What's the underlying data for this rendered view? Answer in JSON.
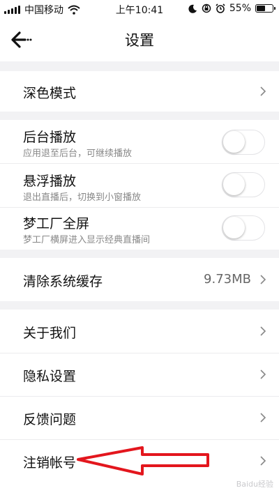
{
  "status_bar": {
    "carrier": "中国移动",
    "time": "上午10:41",
    "battery_percent_label": "55%",
    "battery_level": 0.55,
    "icons": [
      "signal-icon",
      "wifi-icon",
      "moon-icon",
      "orientation-lock-icon",
      "alarm-icon",
      "battery-icon"
    ]
  },
  "header": {
    "title": "设置",
    "back_icon": "back-arrow-icon"
  },
  "sections": {
    "dark_mode": {
      "label": "深色模式"
    },
    "background_play": {
      "label": "后台播放",
      "description": "应用退至后台，可继续播放",
      "enabled": false
    },
    "floating_play": {
      "label": "悬浮播放",
      "description": "退出直播后，切换到小窗播放",
      "enabled": false
    },
    "fullscreen": {
      "label": "梦工厂全屏",
      "description": "梦工厂横屏进入显示经典直播间",
      "enabled": false
    },
    "clear_cache": {
      "label": "清除系统缓存",
      "value": "9.73MB"
    },
    "about": {
      "label": "关于我们"
    },
    "privacy": {
      "label": "隐私设置"
    },
    "feedback": {
      "label": "反馈问题"
    },
    "delete_account": {
      "label": "注销帐号"
    }
  },
  "annotation": {
    "color": "#e3161d",
    "icon": "red-arrow-annotation"
  },
  "watermark": {
    "text": "Baidu经验"
  }
}
